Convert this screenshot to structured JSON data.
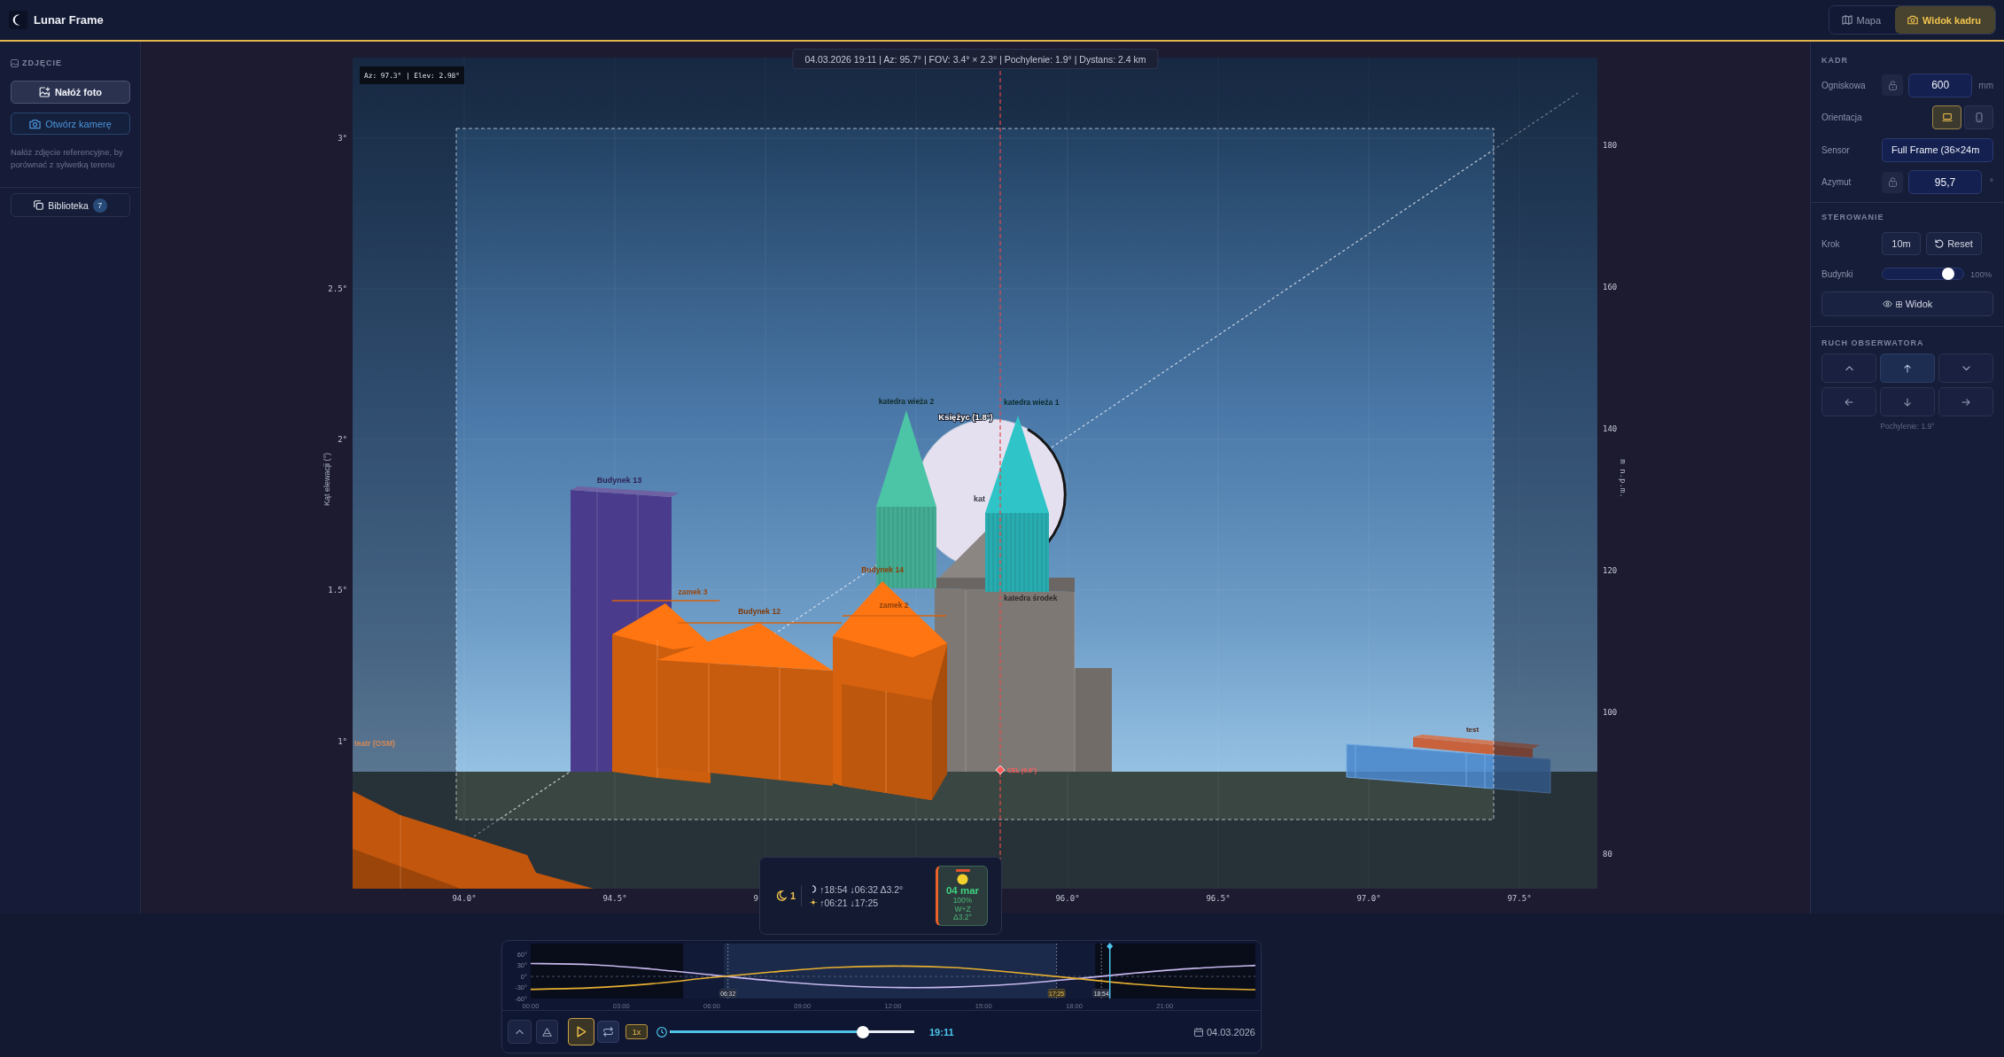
{
  "app": {
    "title": "Lunar Frame"
  },
  "view_tabs": [
    {
      "label": "Mapa",
      "kind": "map",
      "selected": false
    },
    {
      "label": "Widok kadru",
      "kind": "camera",
      "selected": true
    }
  ],
  "sidebar": {
    "section_title": "ZDJĘCIE",
    "buttons": [
      {
        "label": "Nałóż foto",
        "kind": "overlay"
      },
      {
        "label": "Otwórz kamerę",
        "kind": "camera"
      }
    ],
    "hint": "Nałóż zdjęcie referencyjne, by porównać z sylwetką terenu",
    "library": {
      "label": "Biblioteka",
      "count": "7"
    }
  },
  "scene": {
    "info_bar": "04.03.2026 19:11 | Az: 95.7° | FOV: 3.4° × 2.3° | Pochylenie: 1.9° | Dystans: 2.4 km",
    "cursor_readout": "Az: 97.3° | Elev: 2.98°",
    "y_axis": {
      "title": "Kąt elewacji (°)",
      "ticks": [
        "3°",
        "2.5°",
        "2°",
        "1.5°",
        "1°"
      ]
    },
    "y2_axis": {
      "title": "m n.p.m.",
      "ticks": [
        "180",
        "160",
        "140",
        "120",
        "100",
        "80"
      ]
    },
    "x_axis": {
      "ticks": [
        "94.0°",
        "94.5°",
        "9",
        "96.0°",
        "96.5°",
        "97.0°",
        "97.5°"
      ]
    },
    "moon": {
      "label": "Księżyc (1.8°)",
      "inner_label": "kat"
    },
    "objects": [
      {
        "label": "teatr (OSM)",
        "kind": "terrain",
        "color": "#c2560d"
      },
      {
        "label": "Budynek 13",
        "kind": "block",
        "color": "#4b3b8c"
      },
      {
        "label": "test",
        "kind": "box",
        "color": "#c8623c"
      },
      {
        "label": "katedra środek",
        "kind": "block",
        "color": "#7e7874"
      },
      {
        "label": "katedra wieża 2",
        "kind": "tower",
        "color": "#4cc4a6"
      },
      {
        "label": "katedra wieża 1",
        "kind": "tower",
        "color": "#2ec4c8"
      },
      {
        "label": "zamek 3",
        "kind": "gabled",
        "color": "#ff7512"
      },
      {
        "label": "Budynek 12",
        "kind": "gabled",
        "color": "#ff7512"
      },
      {
        "label": "Budynek 14",
        "kind": "gabled",
        "color": "#ff7512"
      },
      {
        "label": "zamek 2",
        "kind": "gabled",
        "color": "#ff7512"
      }
    ],
    "target": {
      "label": "CEL (0.9°)"
    }
  },
  "moon_popup": {
    "count": "1",
    "moon_times": "↑18:54 ↓06:32 Δ3.2°",
    "sun_times": "↑06:21 ↓17:25",
    "day_card": {
      "date": "04 mar",
      "illumination": "100%",
      "phase": "W+Z",
      "delta": "Δ3.2°",
      "selected": true
    }
  },
  "timeline": {
    "chart_data": {
      "type": "line",
      "x": [
        0,
        2,
        4,
        6,
        8,
        10,
        12,
        14,
        16,
        18,
        20,
        22,
        24
      ],
      "series": [
        {
          "color": "#c8b8ee",
          "values": [
            35,
            32,
            20,
            4,
            -12,
            -24,
            -30,
            -29,
            -21,
            -7,
            9,
            22,
            30
          ]
        },
        {
          "color": "#e8b030",
          "values": [
            -35,
            -31,
            -20,
            -3,
            12,
            24,
            28,
            24,
            11,
            -5,
            -21,
            -32,
            -36
          ]
        }
      ],
      "xlim": [
        0,
        24
      ],
      "ylim": [
        -60,
        89
      ],
      "xticks": [
        {
          "value": 0,
          "label": "00:00"
        },
        {
          "value": 3,
          "label": "03:00"
        },
        {
          "value": 6,
          "label": "06:00"
        },
        {
          "value": 9,
          "label": "09:00"
        },
        {
          "value": 12,
          "label": "12:00"
        },
        {
          "value": 15,
          "label": "15:00"
        },
        {
          "value": 18,
          "label": "18:00"
        },
        {
          "value": 21,
          "label": "21:00"
        }
      ],
      "yticks": [
        {
          "value": 60,
          "label": "60°"
        },
        {
          "value": 30,
          "label": "30°"
        },
        {
          "value": 0,
          "label": "0°"
        },
        {
          "value": -30,
          "label": "-30°"
        },
        {
          "value": -60,
          "label": "-60°"
        }
      ],
      "bands": [
        {
          "axis": "x",
          "from": 5.05,
          "to": 18.7,
          "color": "#111a36"
        },
        {
          "axis": "x",
          "from": 6.4,
          "to": 17.4,
          "color": "#1b2a4a"
        }
      ],
      "ref_lines": [
        {
          "axis": "x",
          "value": 19.18
        }
      ],
      "annotations": [
        {
          "x": 6.533,
          "text": "06:32"
        },
        {
          "x": 17.417,
          "text": "17:25"
        },
        {
          "x": 18.9,
          "text": "18:54"
        }
      ]
    },
    "controls": {
      "playing": false,
      "speed": "1x",
      "time_slider": {
        "level": 0.79
      },
      "time": "19:11",
      "date": "04.03.2026"
    }
  },
  "frame_panel": {
    "title": "KADR",
    "focal": {
      "label": "Ogniskowa",
      "locked": false,
      "value": "600",
      "unit": "mm"
    },
    "orientation": {
      "label": "Orientacja",
      "options": [
        {
          "kind": "landscape",
          "selected": true
        },
        {
          "kind": "portrait",
          "selected": false
        }
      ]
    },
    "sensor": {
      "label": "Sensor",
      "value": "Full Frame (36×24m"
    },
    "azimuth": {
      "label": "Azymut",
      "locked": false,
      "value": "95,7",
      "unit": "°"
    }
  },
  "control_panel": {
    "title": "STEROWANIE",
    "step": {
      "label": "Krok",
      "value": "10m"
    },
    "reset": {
      "label": "Reset"
    },
    "buildings": {
      "label": "Budynki",
      "level": 0.87,
      "reading": "100%"
    },
    "view_button": {
      "label": "Widok"
    }
  },
  "observer_panel": {
    "title": "RUCH OBSERWATORA",
    "buttons": [
      {
        "kind": "chevron_up",
        "active": false
      },
      {
        "kind": "arrow_up",
        "active": true
      },
      {
        "kind": "chevron_down",
        "active": false
      },
      {
        "kind": "arrow_left",
        "active": false
      },
      {
        "kind": "arrow_down",
        "active": false
      },
      {
        "kind": "arrow_right",
        "active": false
      }
    ],
    "tilt": "Pochylenie: 1.9°"
  }
}
